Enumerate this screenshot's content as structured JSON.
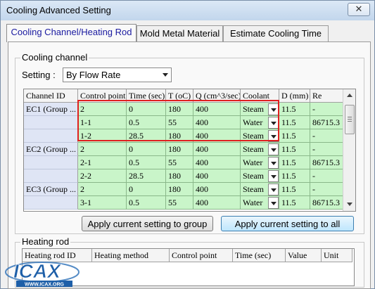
{
  "window": {
    "title": "Cooling Advanced Setting",
    "close_icon": "close-icon"
  },
  "tabs": [
    {
      "label": "Cooling Channel/Heating Rod",
      "active": true
    },
    {
      "label": "Mold Metal Material",
      "active": false
    },
    {
      "label": "Estimate Cooling Time",
      "active": false
    }
  ],
  "cooling": {
    "group_label": "Cooling channel",
    "setting_label": "Setting :",
    "setting_value": "By Flow Rate",
    "columns": [
      "Channel ID",
      "Control point",
      "Time (sec)",
      "T (oC)",
      "Q (cm^3/sec)",
      "Coolant",
      "D (mm)",
      "Re"
    ],
    "rows": [
      {
        "id": "EC1 (Group ...",
        "cp": "2",
        "time": "0",
        "t": "180",
        "q": "400",
        "coolant": "Steam",
        "d": "11.5",
        "re": "-"
      },
      {
        "id": "",
        "cp": "1-1",
        "time": "0.5",
        "t": "55",
        "q": "400",
        "coolant": "Water",
        "d": "11.5",
        "re": "86715.3"
      },
      {
        "id": "",
        "cp": "1-2",
        "time": "28.5",
        "t": "180",
        "q": "400",
        "coolant": "Steam",
        "d": "11.5",
        "re": "-"
      },
      {
        "id": "EC2 (Group ...",
        "cp": "2",
        "time": "0",
        "t": "180",
        "q": "400",
        "coolant": "Steam",
        "d": "11.5",
        "re": "-"
      },
      {
        "id": "",
        "cp": "2-1",
        "time": "0.5",
        "t": "55",
        "q": "400",
        "coolant": "Water",
        "d": "11.5",
        "re": "86715.3"
      },
      {
        "id": "",
        "cp": "2-2",
        "time": "28.5",
        "t": "180",
        "q": "400",
        "coolant": "Steam",
        "d": "11.5",
        "re": "-"
      },
      {
        "id": "EC3 (Group ...",
        "cp": "2",
        "time": "0",
        "t": "180",
        "q": "400",
        "coolant": "Steam",
        "d": "11.5",
        "re": "-"
      },
      {
        "id": "",
        "cp": "3-1",
        "time": "0.5",
        "t": "55",
        "q": "400",
        "coolant": "Water",
        "d": "11.5",
        "re": "86715.3"
      }
    ],
    "apply_group_label": "Apply current setting to group",
    "apply_all_label": "Apply current setting to all"
  },
  "heating": {
    "group_label": "Heating rod",
    "columns": [
      "Heating rod ID",
      "Heating method",
      "Control point",
      "Time (sec)",
      "Value",
      "Unit"
    ]
  },
  "logo": {
    "text": "ICAX",
    "url_text": "WWW.ICAX.ORG"
  },
  "colors": {
    "row_green": "#c9f5c9",
    "id_blue": "#dfe5f5",
    "highlight_red": "#e02020",
    "active_tab_text": "#1a1aa0"
  }
}
